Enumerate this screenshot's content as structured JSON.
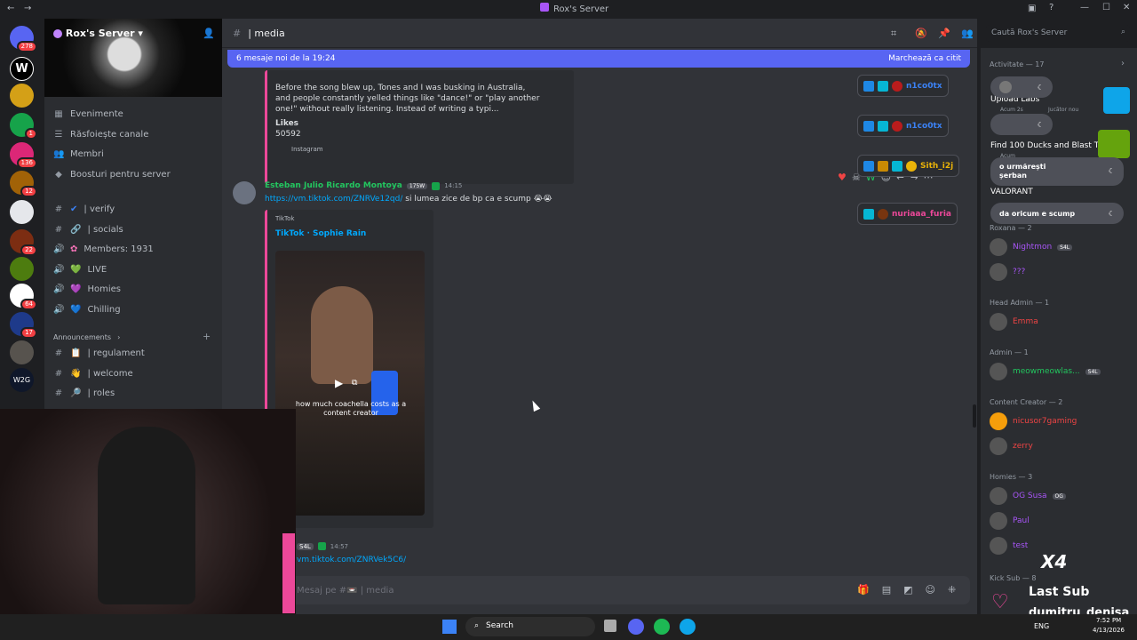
{
  "titlebar": {
    "title": "Rox's Server"
  },
  "rail_badges": [
    "278",
    "1",
    "136",
    "12",
    "22",
    "64",
    "17"
  ],
  "server": {
    "name": "Rox's Server",
    "chevron": "▾"
  },
  "sidebar": {
    "nav": [
      {
        "label": "Evenimente",
        "icon": "calendar-icon"
      },
      {
        "label": "Răsfoiește canale",
        "icon": "browse-icon"
      },
      {
        "label": "Membri",
        "icon": "members-icon"
      },
      {
        "label": "Boosturi pentru server",
        "icon": "boost-icon"
      }
    ],
    "channels": [
      {
        "label": "| verify",
        "glyph": "#",
        "emoji": "✔"
      },
      {
        "label": "| socials",
        "glyph": "#",
        "emoji": "🔗"
      },
      {
        "label": "Members: 1931",
        "glyph": "🔊",
        "emoji": "✿"
      },
      {
        "label": "LIVE",
        "glyph": "🔊",
        "emoji": "💚"
      },
      {
        "label": "Homies",
        "glyph": "🔊",
        "emoji": "💜"
      },
      {
        "label": "Chilling",
        "glyph": "🔊",
        "emoji": "💙"
      }
    ],
    "category": "Announcements",
    "announce_channels": [
      {
        "label": "| regulament",
        "glyph": "#",
        "emoji": "📋"
      },
      {
        "label": "| welcome",
        "glyph": "#",
        "emoji": "👋"
      },
      {
        "label": "| roles",
        "glyph": "#",
        "emoji": "🔎"
      }
    ]
  },
  "header": {
    "channel": "| media",
    "search_placeholder": "Caută Rox's Server"
  },
  "new_messages": {
    "text": "6 mesaje noi de la 19:24",
    "mark_read": "Marchează ca citit"
  },
  "embed1": {
    "text": "Before the song blew up, Tones and I was busking in Australia, and people constantly yelled things like \"dance!\" or \"play another one!\" without really listening. Instead of writing a typi...",
    "likes_label": "Likes",
    "likes_value": "50592",
    "footer": "Instagram"
  },
  "message": {
    "author": "Esteban Julio Ricardo Montoya",
    "tag": "175W",
    "time": "14:15",
    "link": "https://vm.tiktok.com/ZNRVe12qd/",
    "text": "si lumea zice de bp ca e scump",
    "emoji": "😭😭",
    "embed_provider": "TikTok",
    "embed_title": "TikTok · Sophie Rain",
    "video_caption": "how much coachella costs as a content creator"
  },
  "message2": {
    "tag": "S4L",
    "time": "14:57",
    "link": "vm.tiktok.com/ZNRVek5C6/"
  },
  "composer": {
    "placeholder": "Mesaj pe #📼 | media"
  },
  "voice_pills": [
    {
      "name": "n1co0tx",
      "color": "#3b82f6"
    },
    {
      "name": "n1co0tx",
      "color": "#3b82f6"
    },
    {
      "name": "Sith_i2j",
      "color": "#eab308"
    },
    {
      "name": "nuriaaa_furia",
      "color": "#ec4899"
    }
  ],
  "notifications": [
    {
      "text": "o urmărești\nșerban"
    },
    {
      "text": "da oricum e scump"
    }
  ],
  "members": {
    "activity_header": "Activitate — 17",
    "activities": [
      {
        "title": "Upload Labs",
        "sub": "Acum 2s",
        "sub2": "Jucător nou"
      },
      {
        "title": "Find 100 Ducks and Blast T...",
        "sub": "Acum"
      },
      {
        "title": "VALORANT",
        "sub": ""
      }
    ],
    "groups": [
      {
        "header": "Roxana — 2",
        "members": [
          {
            "name": "Nightmon",
            "color": "#a855f7",
            "tag": "S4L"
          },
          {
            "name": "???",
            "color": "#a855f7"
          }
        ]
      },
      {
        "header": "Head Admin — 1",
        "members": [
          {
            "name": "Emma",
            "color": "#ef4444"
          }
        ]
      },
      {
        "header": "Admin — 1",
        "members": [
          {
            "name": "meowmeowlas...",
            "color": "#22c55e",
            "tag": "S4L"
          }
        ]
      },
      {
        "header": "Content Creator — 2",
        "members": [
          {
            "name": "nicusor7gaming",
            "color": "#ef4444"
          },
          {
            "name": "zerry",
            "color": "#ef4444"
          }
        ]
      },
      {
        "header": "Homies — 3",
        "members": [
          {
            "name": "OG Susa",
            "color": "#a855f7",
            "tag": "OG"
          },
          {
            "name": "Paul",
            "color": "#a855f7"
          },
          {
            "name": "test",
            "color": "#a855f7"
          }
        ]
      },
      {
        "header": "Kick Sub — 8",
        "members": []
      }
    ]
  },
  "overlay": {
    "counter": "X4",
    "last_sub": "Last Sub",
    "sub_name": "dumitru_denisa"
  },
  "taskbar": {
    "search": "Search",
    "lang": "ENG",
    "time": "7:52 PM",
    "date": "4/13/2026"
  }
}
